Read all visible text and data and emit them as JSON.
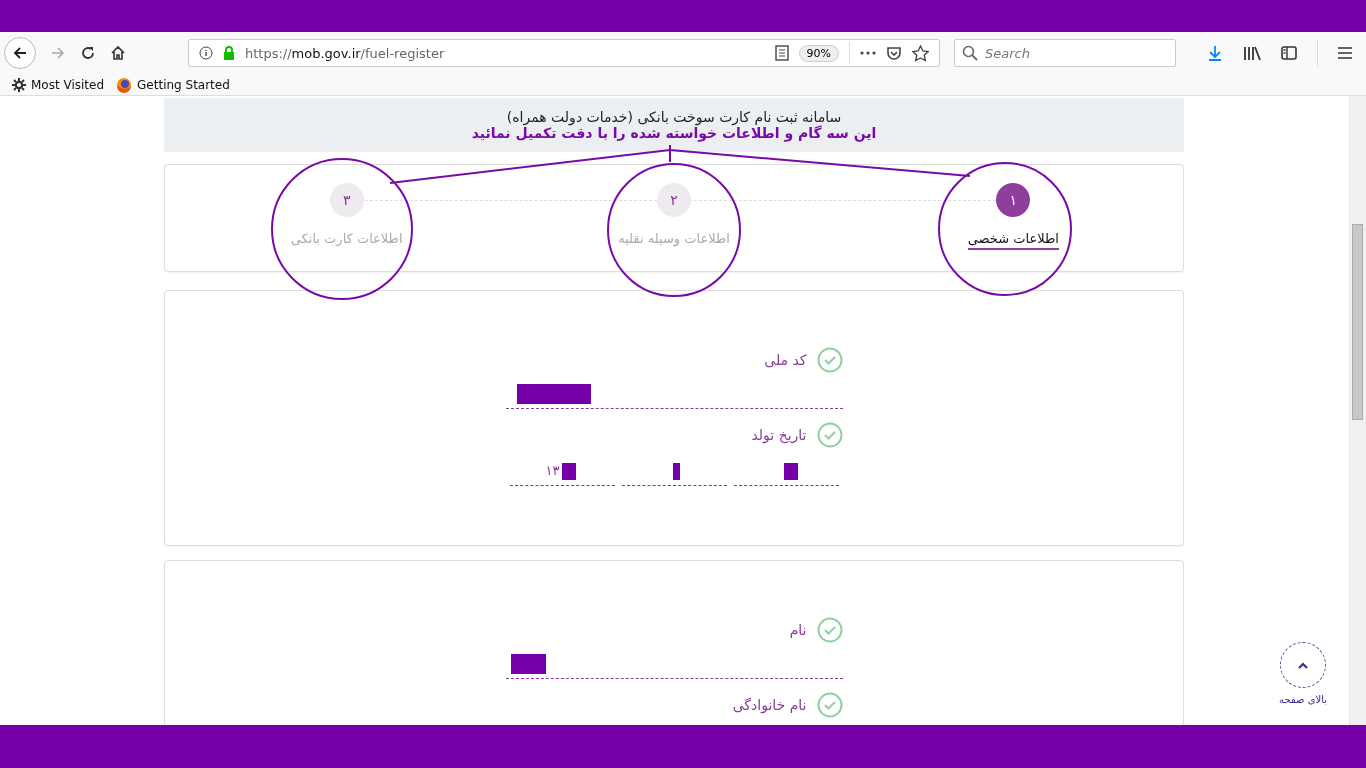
{
  "browser": {
    "url_scheme": "https://",
    "url_host": "mob.gov.ir",
    "url_path": "/fuel-register",
    "zoom": "90%",
    "search_placeholder": "Search",
    "bookmark_left": "Most Visited",
    "bookmark_right": "Getting Started"
  },
  "header": {
    "title": "سامانه ثبت نام کارت سوخت بانکی (خدمات دولت همراه)",
    "subtitle": "این سه گام و اطلاعات خواسته شده را با دقت تکمیل نمائید"
  },
  "steps": [
    {
      "number": "۱",
      "label": "اطلاعات شخصی",
      "selected": true
    },
    {
      "number": "۲",
      "label": "اطلاعات وسیله نقلیه",
      "selected": false
    },
    {
      "number": "۳",
      "label": "اطلاعات کارت بانکی",
      "selected": false
    }
  ],
  "sections": [
    {
      "fields": [
        {
          "kind": "text",
          "label": "کد ملی",
          "valid": true,
          "redacted": true
        },
        {
          "kind": "date",
          "label": "تاریخ تولد",
          "valid": true,
          "parts": [
            {
              "redacted": true
            },
            {
              "redacted": true
            },
            {
              "value": "۱۳",
              "redacted": true
            }
          ]
        }
      ]
    },
    {
      "fields": [
        {
          "kind": "text",
          "label": "نام",
          "valid": true,
          "redacted": true
        },
        {
          "kind": "label",
          "label": "نام خانوادگی",
          "valid": true
        }
      ]
    }
  ],
  "back_to_top": "بالای صفحه"
}
